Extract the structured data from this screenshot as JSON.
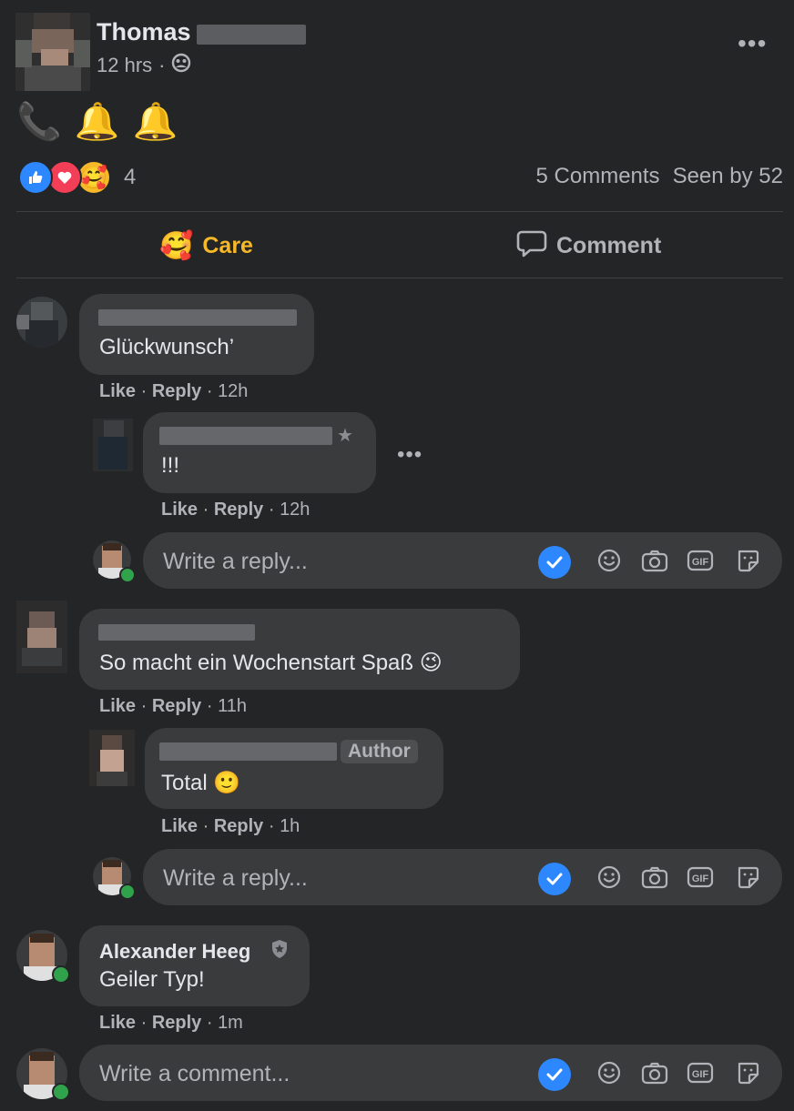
{
  "post": {
    "author_first_name": "Thomas",
    "time": "12 hrs",
    "body_emojis": [
      "📞",
      "🔔",
      "🔔"
    ],
    "reaction_count": "4",
    "comments_label": "5 Comments",
    "seen_label": "Seen by 52"
  },
  "actions": {
    "care_label": "Care",
    "comment_label": "Comment"
  },
  "comments": [
    {
      "text": "Glückwunsch’",
      "like": "Like",
      "reply": "Reply",
      "time": "12h",
      "replies": [
        {
          "text": "!!!",
          "like": "Like",
          "reply": "Reply",
          "time": "12h"
        }
      ],
      "reply_input_placeholder": "Write a reply..."
    },
    {
      "text": "So macht ein Wochenstart Spaß 😉",
      "like": "Like",
      "reply": "Reply",
      "time": "11h",
      "replies": [
        {
          "badge": "Author",
          "text": "Total 🙂",
          "like": "Like",
          "reply": "Reply",
          "time": "1h"
        }
      ],
      "reply_input_placeholder": "Write a reply..."
    },
    {
      "name": "Alexander Heeg",
      "text": "Geiler Typ!",
      "like": "Like",
      "reply": "Reply",
      "time": "1m"
    }
  ],
  "composer": {
    "placeholder": "Write a comment..."
  },
  "colors": {
    "background": "#242526",
    "bubble": "#3a3b3c",
    "care_yellow": "#f7b928",
    "like_blue": "#2d88ff",
    "online_green": "#31a24c"
  },
  "icons": [
    "more-options-icon",
    "friends-audience-icon",
    "like-reaction-icon",
    "love-reaction-icon",
    "care-reaction-icon",
    "comment-bubble-icon",
    "checkmark-icon",
    "emoji-icon",
    "camera-icon",
    "gif-icon",
    "sticker-icon",
    "admin-shield-icon"
  ]
}
